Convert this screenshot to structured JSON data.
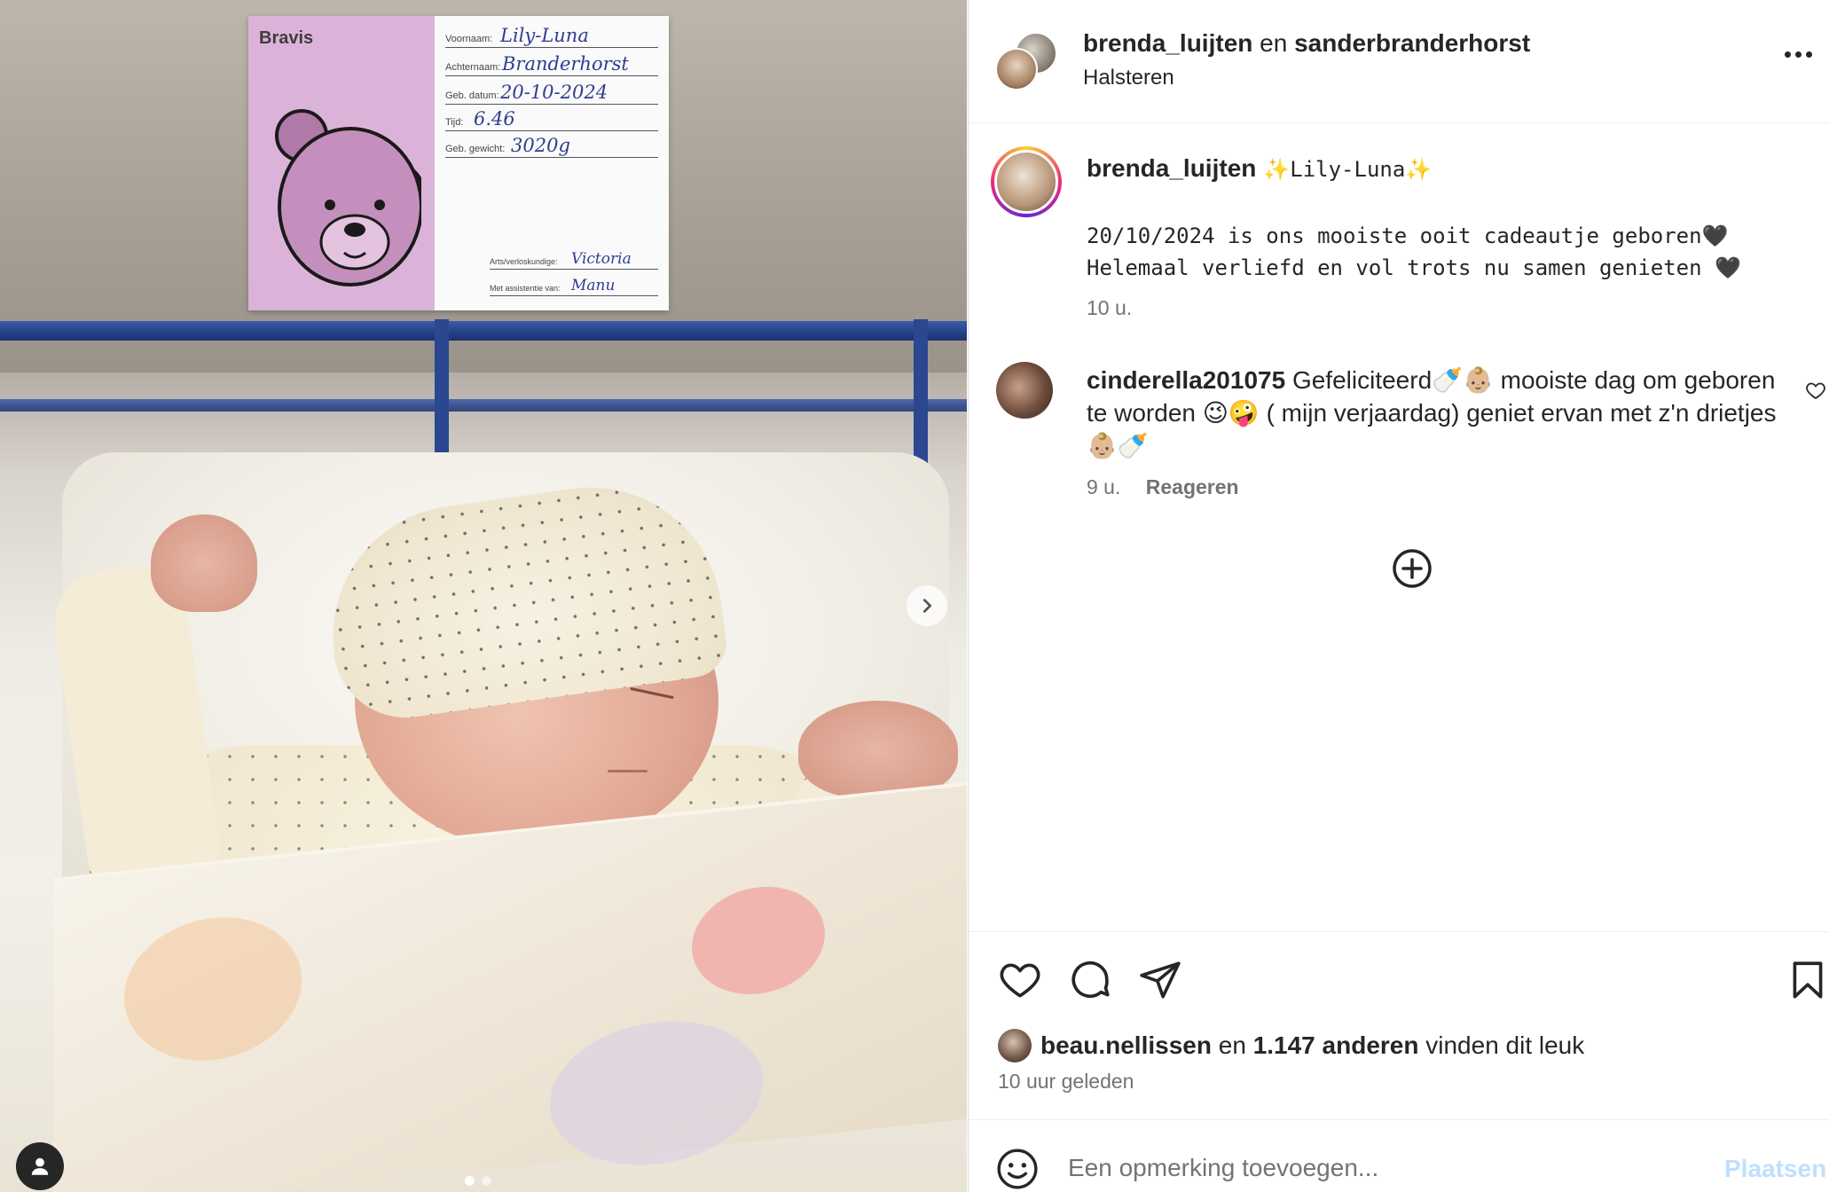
{
  "media": {
    "namecard": {
      "brand": "Bravis",
      "fields": [
        {
          "label": "Voornaam:",
          "value": "Lily-Luna"
        },
        {
          "label": "Achternaam:",
          "value": "Branderhorst"
        },
        {
          "label": "Geb. datum:",
          "value": "20-10-2024"
        },
        {
          "label": "Tijd:",
          "value": "6.46"
        },
        {
          "label": "Geb. gewicht:",
          "value": "3020g"
        }
      ],
      "staff": [
        {
          "label": "Arts/verloskundige:",
          "value": "Victoria"
        },
        {
          "label": "Met assistentie van:",
          "value": "Manu"
        }
      ]
    },
    "carousel": {
      "count": 2,
      "active_index": 0
    }
  },
  "header": {
    "user1": "brenda_luijten",
    "conjunction": "en",
    "user2": "sanderbranderhorst",
    "location": "Halsteren"
  },
  "caption": {
    "username": "brenda_luijten",
    "title": "✨Lily-Luna✨",
    "text": "20/10/2024 is ons mooiste ooit cadeautje geboren🖤\nHelemaal verliefd en vol trots nu samen genieten 🖤",
    "time": "10 u."
  },
  "comment": {
    "username": "cinderella201075",
    "text": "Gefeliciteerd🍼👶🏼 mooiste dag om geboren te worden 😉🤪 ( mijn verjaardag) geniet ervan met z'n drietjes 👶🏼🍼",
    "time": "9 u.",
    "reply_label": "Reageren"
  },
  "likes": {
    "user": "beau.nellissen",
    "conj": "en",
    "count_text": "1.147 anderen",
    "suffix": "vinden dit leuk"
  },
  "post_time": "10 uur geleden",
  "composer": {
    "placeholder": "Een opmerking toevoegen...",
    "post_label": "Plaatsen"
  },
  "icons": {
    "like": "heart-icon",
    "comment": "comment-bubble-icon",
    "share": "paper-plane-icon",
    "save": "bookmark-icon",
    "more": "more-dots-icon",
    "load_more": "plus-circle-icon",
    "emoji": "smiley-icon",
    "next": "chevron-right-icon",
    "tags": "user-tag-icon"
  },
  "colors": {
    "text": "#262626",
    "secondary": "#737373",
    "post_button_disabled": "#c0dffd",
    "card_pink": "#dcb3d8",
    "card_ink": "#2f3d8f",
    "crib_blue": "#243f85"
  }
}
